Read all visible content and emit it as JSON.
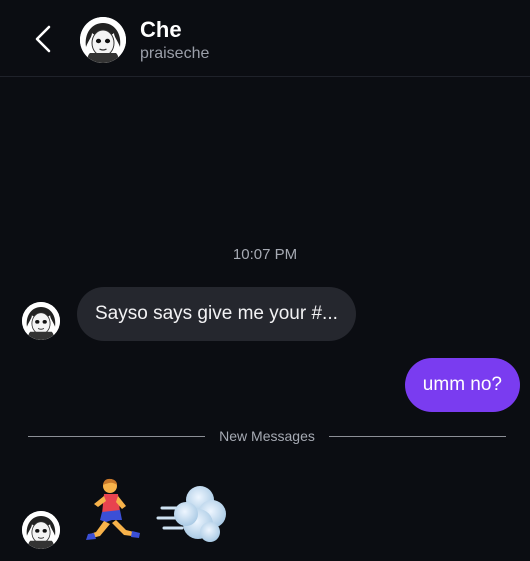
{
  "header": {
    "name": "Che",
    "username": "praiseche"
  },
  "conversation": {
    "timestamp": "10:07 PM",
    "incoming_text": "Sayso says give me your #...",
    "outgoing_text": "umm no?",
    "divider_label": "New Messages",
    "emoji_message": [
      "person-running-emoji",
      "dashing-away-emoji"
    ]
  },
  "colors": {
    "background": "#0b0d12",
    "incoming_bubble": "#25272e",
    "outgoing_bubble": "#7a3cf0"
  }
}
